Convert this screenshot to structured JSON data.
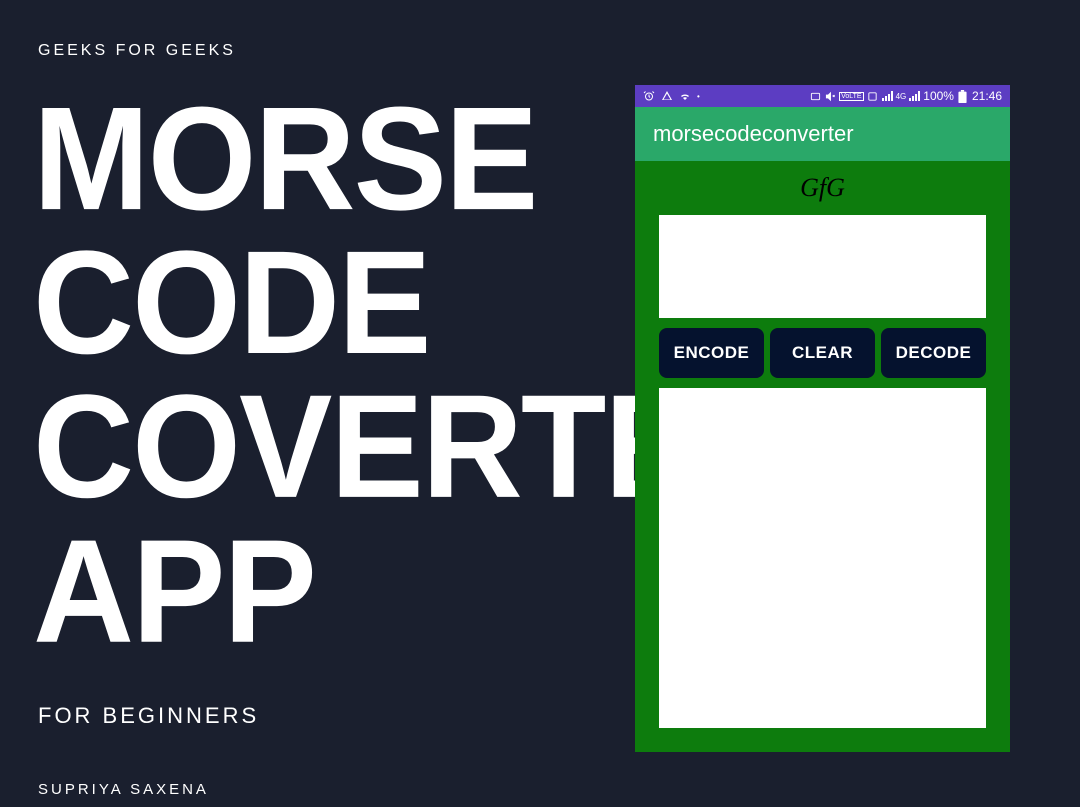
{
  "header": "GEEKS  FOR GEEKS",
  "title_line1": "MORSE",
  "title_line2": "CODE",
  "title_line3": "COVERTER",
  "title_line4": "APP",
  "subtitle": "FOR BEGINNERS",
  "author": "SUPRIYA SAXENA",
  "phone": {
    "status_bar": {
      "battery_percent": "100%",
      "time": "21:46",
      "network_label": "4G",
      "lte_label": "LTE",
      "volte_label": "VoLTE"
    },
    "app_bar_title": "morsecodeconverter",
    "app_label": "GfG",
    "buttons": {
      "encode": "ENCODE",
      "clear": "CLEAR",
      "decode": "DECODE"
    }
  }
}
